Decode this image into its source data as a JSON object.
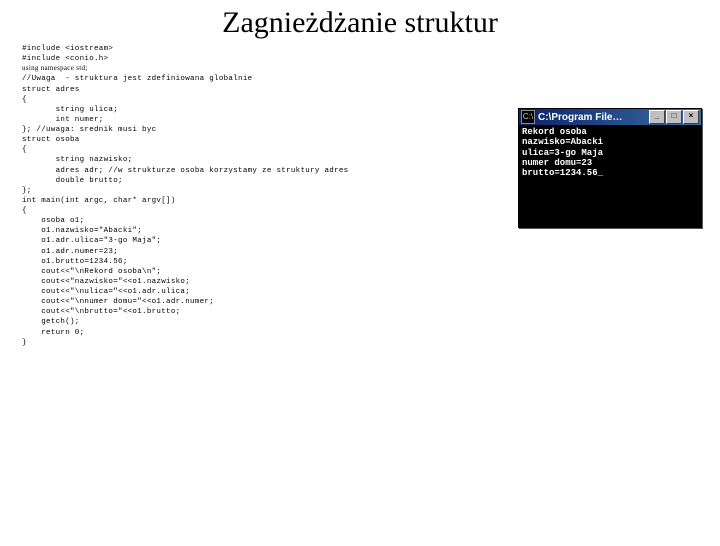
{
  "title": "Zagnieżdżanie struktur",
  "code": {
    "l01": "#include <iostream>",
    "l02": "#include <conio.h>",
    "l03a": "using namespace std;",
    "l04": "//Uwaga  - struktura jest zdefiniowana globalnie",
    "l05": "struct adres",
    "l06": "{",
    "l07": "       string ulica;",
    "l08": "       int numer;",
    "l09": "}; //uwaga: srednik musi byc",
    "l10": "struct osoba",
    "l11": "{",
    "l12": "       string nazwisko;",
    "l13": "       adres adr; //w strukturze osoba korzystamy ze struktury adres",
    "l14": "       double brutto;",
    "l15": "};",
    "l16": "int main(int argc, char* argv[])",
    "l17": "{",
    "l18": "    osoba o1;",
    "l19": "    o1.nazwisko=\"Abacki\";",
    "l20": "    o1.adr.ulica=\"3-go Maja\";",
    "l21": "    o1.adr.numer=23;",
    "l22": "    o1.brutto=1234.56;",
    "l23": "    cout<<\"\\nRekord osoba\\n\";",
    "l24": "    cout<<\"nazwisko=\"<<o1.nazwisko;",
    "l25": "    cout<<\"\\nulica=\"<<o1.adr.ulica;",
    "l26": "    cout<<\"\\nnumer domu=\"<<o1.adr.numer;",
    "l27": "    cout<<\"\\nbrutto=\"<<o1.brutto;",
    "l28": "    getch();",
    "l29": "    return 0;",
    "l30": "}"
  },
  "console": {
    "title": "C:\\Program File…",
    "min": "_",
    "max": "□",
    "close": "×",
    "out1": "Rekord osoba",
    "out2": "nazwisko=Abacki",
    "out3": "ulica=3-go Maja",
    "out4": "numer domu=23",
    "out5": "brutto=1234.56_"
  }
}
